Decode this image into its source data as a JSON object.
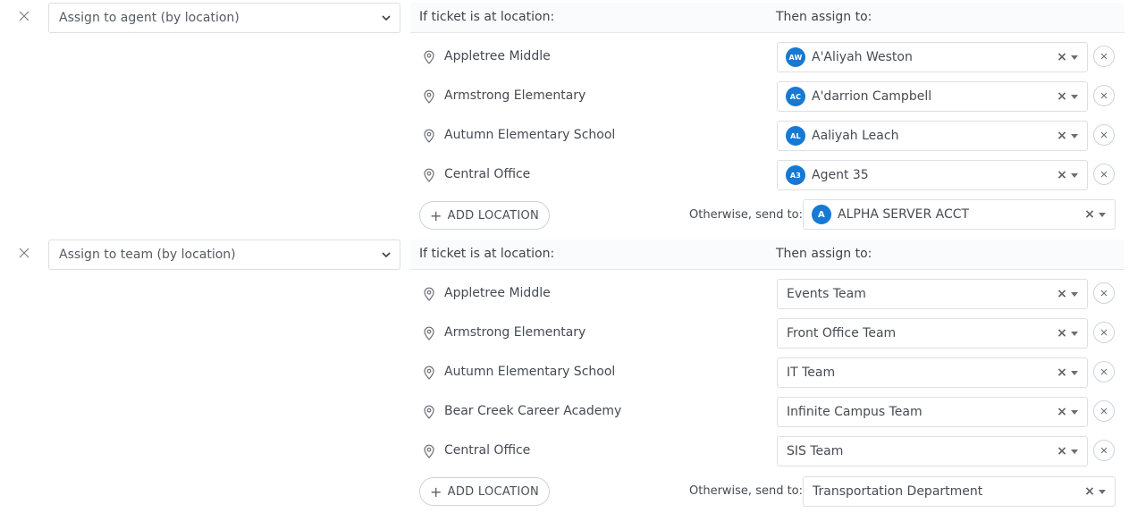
{
  "colors": {
    "avatar_bg": "#1679d3",
    "border": "#dcdfe3",
    "header_bg": "#fafbfc"
  },
  "rules": [
    {
      "action": "Assign to agent (by location)",
      "header_location": "If ticket is at location:",
      "header_assign": "Then assign to:",
      "rows": [
        {
          "location": "Appletree Middle",
          "initials": "AW",
          "assignee": "A'Aliyah Weston"
        },
        {
          "location": "Armstrong Elementary",
          "initials": "AC",
          "assignee": "A'darrion Campbell"
        },
        {
          "location": "Autumn Elementary School",
          "initials": "AL",
          "assignee": "Aaliyah Leach"
        },
        {
          "location": "Central Office",
          "initials": "A3",
          "assignee": "Agent 35"
        }
      ],
      "add_label": "ADD LOCATION",
      "otherwise_label": "Otherwise, send to:",
      "otherwise_initials": "A",
      "otherwise_value": "ALPHA SERVER ACCT"
    },
    {
      "action": "Assign to team (by location)",
      "header_location": "If ticket is at location:",
      "header_assign": "Then assign to:",
      "rows": [
        {
          "location": "Appletree Middle",
          "assignee": "Events Team"
        },
        {
          "location": "Armstrong Elementary",
          "assignee": "Front Office Team"
        },
        {
          "location": "Autumn Elementary School",
          "assignee": "IT Team"
        },
        {
          "location": "Bear Creek Career Academy",
          "assignee": "Infinite Campus Team"
        },
        {
          "location": "Central Office",
          "assignee": "SIS Team"
        }
      ],
      "add_label": "ADD LOCATION",
      "otherwise_label": "Otherwise, send to:",
      "otherwise_value": "Transportation Department"
    }
  ]
}
